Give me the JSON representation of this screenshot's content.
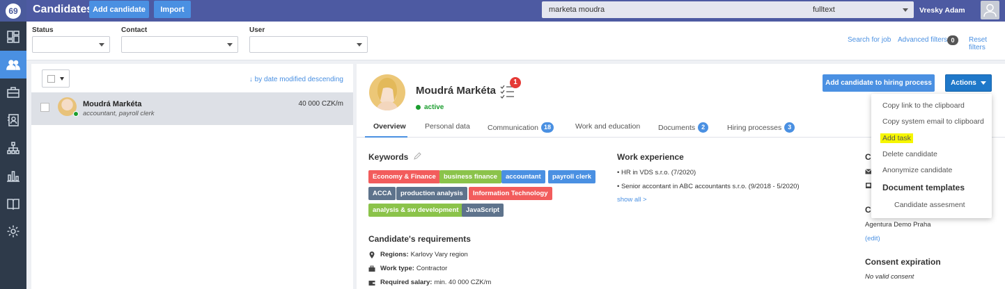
{
  "header": {
    "title": "Candidates",
    "add_candidate": "Add candidate",
    "import": "Import",
    "search_value": "marketa moudra",
    "search_mode": "fulltext",
    "user_name": "Vresky Adam"
  },
  "filters": {
    "status_label": "Status",
    "contact_label": "Contact",
    "user_label": "User",
    "search_for_job": "Search for job",
    "advanced_filters": "Advanced filters",
    "advanced_filters_count": "0",
    "reset_filters": "Reset filters"
  },
  "list": {
    "sort_label": "↓ by date modified descending",
    "rows": [
      {
        "name": "Moudrá Markéta",
        "subtitle": "accountant, payroll clerk",
        "salary": "40 000 CZK/m"
      }
    ]
  },
  "candidate": {
    "name": "Moudrá Markéta",
    "status": "active",
    "task_count": "1",
    "add_to_hiring": "Add candidate to hiring process",
    "actions": "Actions"
  },
  "tabs": [
    {
      "label": "Overview"
    },
    {
      "label": "Personal data"
    },
    {
      "label": "Communication",
      "badge": "18"
    },
    {
      "label": "Work and education"
    },
    {
      "label": "Documents",
      "badge": "2"
    },
    {
      "label": "Hiring processes",
      "badge": "3"
    }
  ],
  "keywords": {
    "title": "Keywords",
    "tags": [
      {
        "label": "Economy & Finance",
        "color": "#f25c5c"
      },
      {
        "label": "business finance",
        "color": "#8bc34a"
      },
      {
        "label": "accountant",
        "color": "#4a90e2"
      },
      {
        "label": "payroll clerk",
        "color": "#4a90e2"
      },
      {
        "label": "ACCA",
        "color": "#5e738c"
      },
      {
        "label": "production analysis",
        "color": "#5e738c"
      },
      {
        "label": "Information Technology",
        "color": "#f25c5c"
      },
      {
        "label": "analysis & sw development",
        "color": "#8bc34a"
      },
      {
        "label": "JavaScript",
        "color": "#5e738c"
      }
    ]
  },
  "work_experience": {
    "title": "Work experience",
    "items": [
      "• HR in VDS s.r.o. (7/2020)",
      "• Senior accontant in ABC accountants s.r.o. (9/2018 - 5/2020)"
    ],
    "show_all": "show all >"
  },
  "requirements": {
    "title": "Candidate's requirements",
    "regions_label": "Regions:",
    "regions_value": "Karlovy Vary region",
    "work_type_label": "Work type:",
    "work_type_value": "Contractor",
    "salary_label": "Required salary:",
    "salary_value": "min. 40 000 CZK/m"
  },
  "right_col": {
    "title_c1": "C",
    "title_c2": "C",
    "agency": "Agentura Demo Praha",
    "edit": "(edit)",
    "consent_title": "Consent expiration",
    "consent_value": "No valid consent"
  },
  "actions_menu": {
    "items": [
      "Copy link to the clipboard",
      "Copy system email to clipboard",
      "Add task",
      "Delete candidate",
      "Anonymize candidate"
    ],
    "templates_heading": "Document templates",
    "templates": [
      "Candidate assesment"
    ]
  }
}
